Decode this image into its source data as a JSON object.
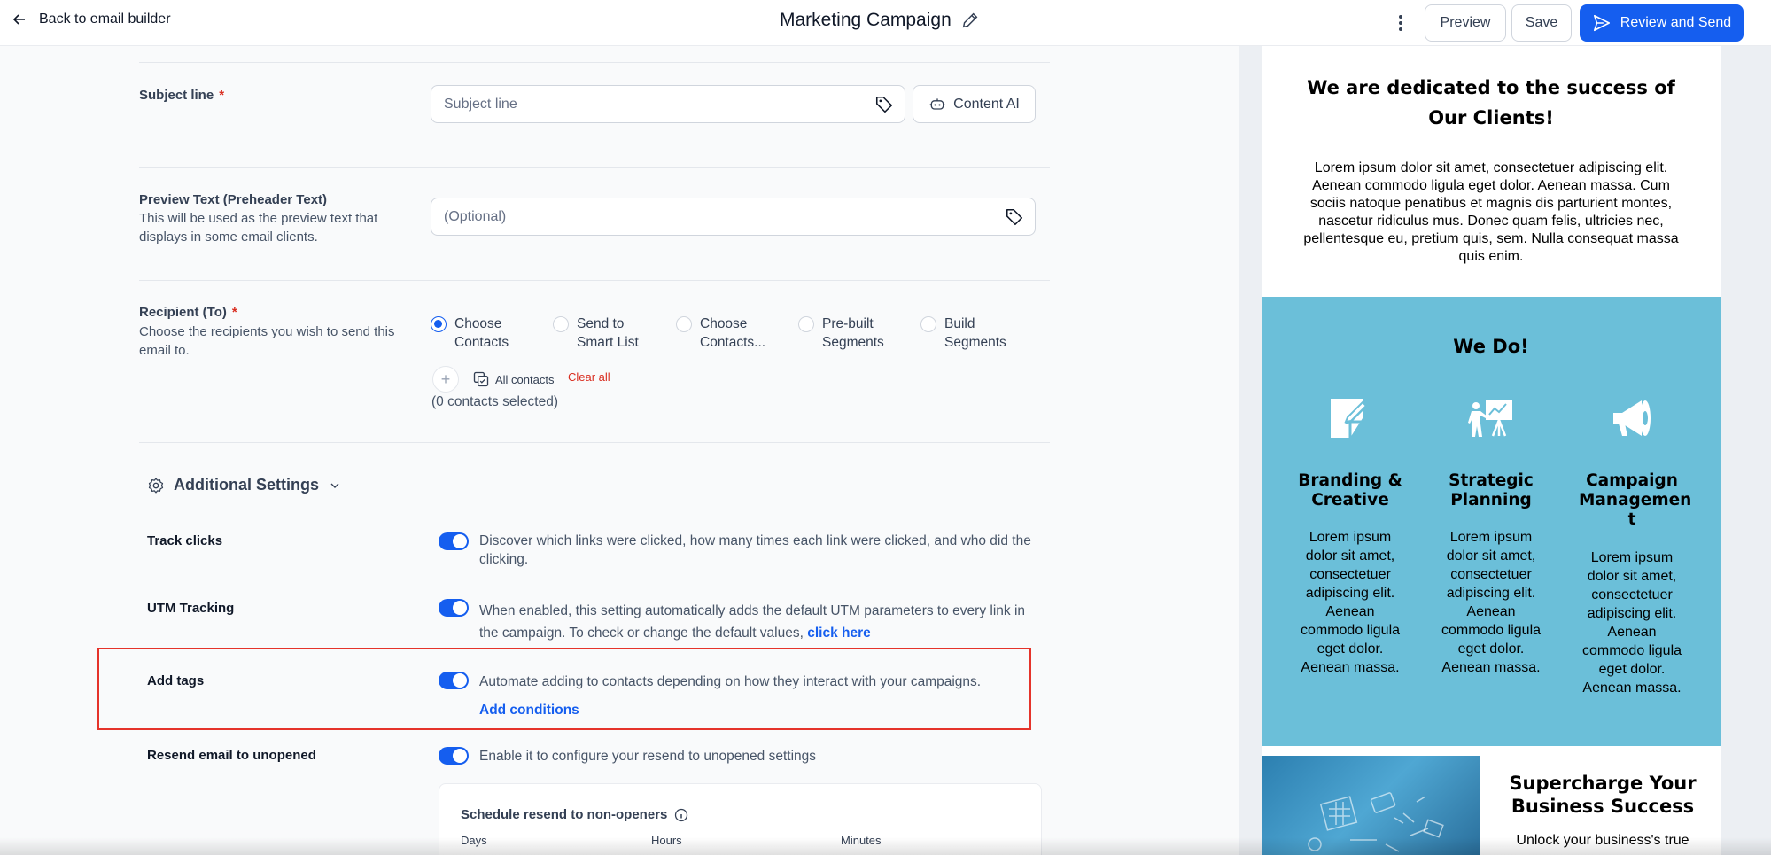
{
  "header": {
    "back_label": "Back to email builder",
    "title": "Marketing Campaign",
    "preview_label": "Preview",
    "save_label": "Save",
    "send_label": "Review and Send"
  },
  "form": {
    "subject": {
      "label": "Subject line",
      "required": "*",
      "placeholder": "Subject line",
      "content_ai_label": "Content AI"
    },
    "preview_text": {
      "label": "Preview Text (Preheader Text)",
      "description": "This will be used as the preview text that displays in some email clients.",
      "placeholder": "(Optional)"
    },
    "recipient": {
      "label": "Recipient (To)",
      "required": "*",
      "description": "Choose the recipients you wish to send this email to.",
      "options": [
        {
          "line1": "Choose",
          "line2": "Contacts",
          "selected": true
        },
        {
          "line1": "Send to",
          "line2": "Smart List",
          "selected": false
        },
        {
          "line1": "Choose",
          "line2": "Contacts...",
          "selected": false
        },
        {
          "line1": "Pre-built",
          "line2": "Segments",
          "selected": false
        },
        {
          "line1": "Build",
          "line2": "Segments",
          "selected": false
        }
      ],
      "add_symbol": "+",
      "all_contacts_label": "All contacts",
      "clear_all_label": "Clear all",
      "selected_count": "(0 contacts selected)"
    },
    "additional_settings": {
      "title": "Additional Settings",
      "track_clicks": {
        "label": "Track clicks",
        "description": "Discover which links were clicked, how many times each link were clicked, and who did the clicking.",
        "enabled": true
      },
      "utm": {
        "label": "UTM Tracking",
        "description": "When enabled, this setting automatically adds the default UTM parameters to every link in the campaign. To check or change the default values,",
        "link": "click here",
        "enabled": true
      },
      "add_tags": {
        "label": "Add tags",
        "description": "Automate adding to contacts depending on how they interact with your campaigns.",
        "link": "Add conditions",
        "enabled": true
      },
      "resend": {
        "label": "Resend email to unopened",
        "description": "Enable it to configure your resend to unopened settings",
        "enabled": true,
        "schedule_title": "Schedule resend to non-openers",
        "columns": [
          "Days",
          "Hours",
          "Minutes"
        ]
      }
    }
  },
  "preview": {
    "heading": "We are dedicated to the success of Our Clients!",
    "body": "Lorem ipsum dolor sit amet, consectetuer adipiscing elit. Aenean commodo ligula eget dolor. Aenean massa. Cum sociis natoque penatibus et magnis dis parturient montes, nascetur ridiculus mus. Donec quam felis, ultricies nec, pellentesque eu, pretium quis, sem. Nulla consequat massa quis enim.",
    "we_do": "We Do!",
    "services": [
      {
        "title": "Branding & Creative",
        "text": "Lorem ipsum dolor sit amet, consectetuer adipiscing elit. Aenean commodo ligula eget dolor. Aenean massa.",
        "icon": "edit-page-icon"
      },
      {
        "title": "Strategic Planning",
        "text": "Lorem ipsum dolor sit amet, consectetuer adipiscing elit. Aenean commodo ligula eget dolor. Aenean massa.",
        "icon": "presentation-icon"
      },
      {
        "title": "Campaign Managemen t",
        "text": "Lorem ipsum dolor sit amet, consectetuer adipiscing elit. Aenean commodo ligula eget dolor. Aenean massa.",
        "icon": "megaphone-icon"
      }
    ],
    "supercharge": "Supercharge Your Business Success",
    "unlock": "Unlock your business's true"
  },
  "colors": {
    "primary": "#155eef",
    "danger": "#d92d20",
    "preview_blue": "#6bbfd9",
    "highlight": "#e5332a"
  }
}
